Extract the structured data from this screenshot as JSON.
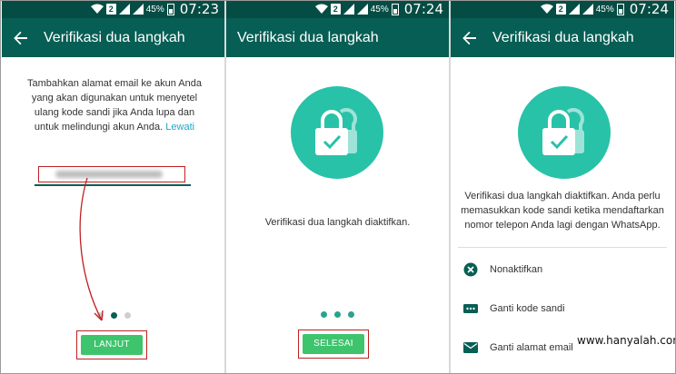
{
  "status": {
    "sim": "2",
    "battery_pct": "45%",
    "times": [
      "07:23",
      "07:24",
      "07:24"
    ]
  },
  "screen1": {
    "title": "Verifikasi dua langkah",
    "instruction": "Tambahkan alamat email ke akun Anda yang akan digunakan untuk menyetel ulang kode sandi jika Anda lupa dan untuk melindungi akun Anda.",
    "skip_link": "Lewati",
    "email_value_visible": "dj...@...",
    "button": "LANJUT",
    "page_index": 1,
    "page_count": 3
  },
  "screen2": {
    "title": "Verifikasi dua langkah",
    "message": "Verifikasi dua langkah diaktifkan.",
    "button": "SELESAI",
    "page_count": 3
  },
  "screen3": {
    "title": "Verifikasi dua langkah",
    "message": "Verifikasi dua langkah diaktifkan. Anda perlu memasukkan kode sandi ketika mendaftarkan nomor telepon Anda lagi dengan WhatsApp.",
    "menu": [
      {
        "label": "Nonaktifkan",
        "icon": "disable-icon"
      },
      {
        "label": "Ganti kode sandi",
        "icon": "password-icon"
      },
      {
        "label": "Ganti alamat email",
        "icon": "email-icon"
      }
    ]
  },
  "watermark": "www.hanyalah.com",
  "colors": {
    "status_bar": "#054d44",
    "app_bar": "#075e54",
    "lock_circle": "#28c2a8",
    "button": "#3ec46d",
    "highlight": "#c02020",
    "link": "#1fa7c4"
  }
}
